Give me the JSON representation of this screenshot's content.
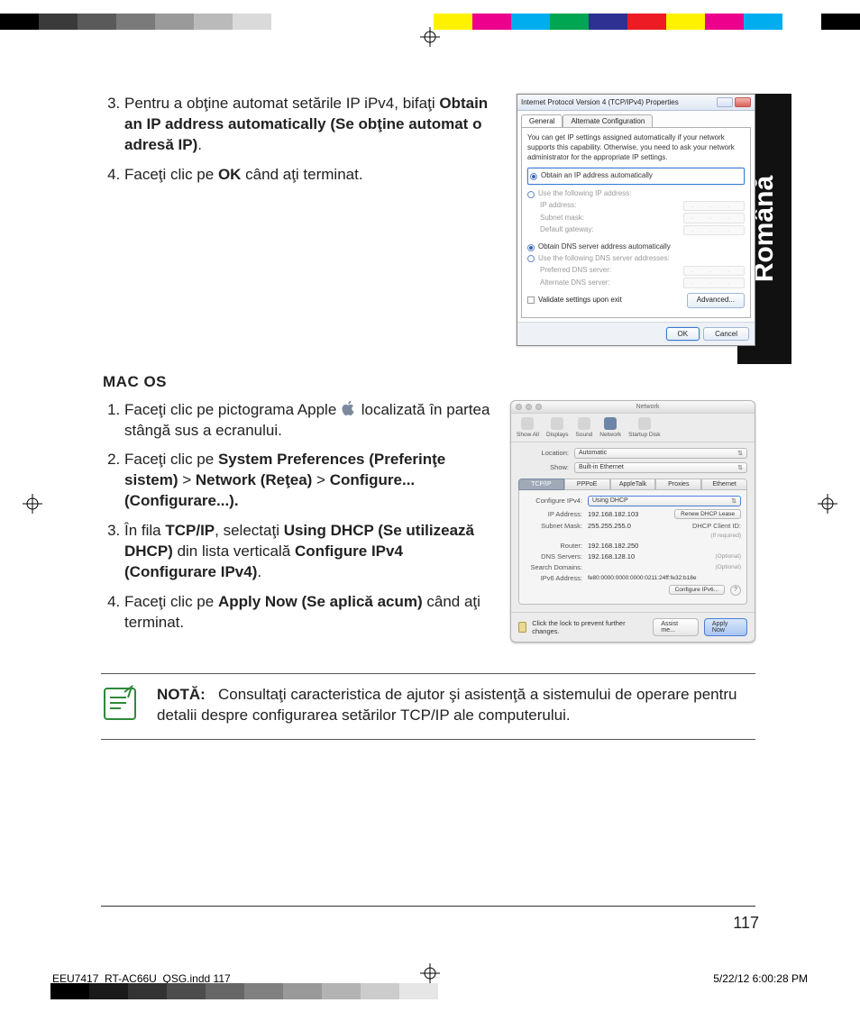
{
  "language_tab": "Română",
  "section1": {
    "start_number": 3,
    "steps": [
      {
        "pre": "Pentru a obţine automat setările IP iPv4, bifaţi ",
        "bold": "Obtain an IP address automatically (Se obţine automat o adresă IP)",
        "post": "."
      },
      {
        "pre": "Faceţi clic pe ",
        "bold": "OK",
        "post": " când aţi terminat."
      }
    ]
  },
  "section2_heading": "MAC OS",
  "section2": {
    "steps": [
      {
        "pre": "Faceţi clic pe pictograma Apple ",
        "post_icon": " localizată în partea stângă sus a ecranului."
      },
      {
        "pre": "Faceţi clic pe ",
        "b1": "System Preferences (Preferinţe sistem)",
        "gt1": " > ",
        "b2": "Network (Reţea)",
        "gt2": " > ",
        "b3": "Configure... (Configurare...).",
        "post": ""
      },
      {
        "pre": "În fila ",
        "b1": "TCP/IP",
        "mid1": ", selectaţi ",
        "b2": "Using DHCP (Se utilizează DHCP)",
        "mid2": " din lista verticală ",
        "b3": "Configure IPv4 (Configurare IPv4)",
        "post": "."
      },
      {
        "pre": "Faceţi clic pe ",
        "b1": "Apply Now (Se aplică acum)",
        "post": " când aţi terminat."
      }
    ]
  },
  "note": {
    "label": "NOTĂ:",
    "text": "Consultaţi caracteristica de ajutor şi asistenţă a sistemului de operare pentru detalii despre configurarea setărilor TCP/IP ale computerului."
  },
  "page_number": "117",
  "imprint_left": "EEU7417_RT-AC66U_QSG.indd   117",
  "imprint_right": "5/22/12   6:00:28 PM",
  "win_dialog": {
    "title": "Internet Protocol Version 4 (TCP/IPv4) Properties",
    "tab_general": "General",
    "tab_alt": "Alternate Configuration",
    "desc": "You can get IP settings assigned automatically if your network supports this capability. Otherwise, you need to ask your network administrator for the appropriate IP settings.",
    "r_auto_ip": "Obtain an IP address automatically",
    "r_use_ip": "Use the following IP address:",
    "f_ip": "IP address:",
    "f_sub": "Subnet mask:",
    "f_gw": "Default gateway:",
    "r_auto_dns": "Obtain DNS server address automatically",
    "r_use_dns": "Use the following DNS server addresses:",
    "f_pdns": "Preferred DNS server:",
    "f_adns": "Alternate DNS server:",
    "chk_validate": "Validate settings upon exit",
    "btn_adv": "Advanced...",
    "btn_ok": "OK",
    "btn_cancel": "Cancel"
  },
  "mac_dialog": {
    "title": "Network",
    "tb_showall": "Show All",
    "tb_displays": "Displays",
    "tb_sound": "Sound",
    "tb_network": "Network",
    "tb_startup": "Startup Disk",
    "loc_label": "Location:",
    "loc_value": "Automatic",
    "show_label": "Show:",
    "show_value": "Built-in Ethernet",
    "tabs": [
      "TCP/IP",
      "PPPoE",
      "AppleTalk",
      "Proxies",
      "Ethernet"
    ],
    "cfg_label": "Configure IPv4:",
    "cfg_value": "Using DHCP",
    "ip_label": "IP Address:",
    "ip_value": "192.168.182.103",
    "renew": "Renew DHCP Lease",
    "sm_label": "Subnet Mask:",
    "sm_value": "255.255.255.0",
    "cid_label": "DHCP Client ID:",
    "cid_hint": "(If required)",
    "rt_label": "Router:",
    "rt_value": "192.168.182.250",
    "dns_label": "DNS Servers:",
    "dns_value": "192.168.128.10",
    "dns_hint": "(Optional)",
    "sd_label": "Search Domains:",
    "sd_hint": "(Optional)",
    "v6_label": "IPv6 Address:",
    "v6_value": "fe80:0000:0000:0000:0211:24ff:fe32:b18e",
    "cfg6": "Configure IPv6...",
    "lock_text": "Click the lock to prevent further changes.",
    "assist": "Assist me...",
    "apply": "Apply Now"
  },
  "color_strip_top": [
    "#000000",
    "#3a3a3a",
    "#5a5a5a",
    "#7a7a7a",
    "#9a9a9a",
    "#bababa",
    "#dadada",
    "#ffffff"
  ],
  "color_strip_right": [
    "#fff200",
    "#ec008c",
    "#00aeef",
    "#00a651",
    "#2e3192",
    "#ed1c24",
    "#fff200",
    "#ec008c",
    "#00aeef",
    "#ffffff",
    "#000000"
  ],
  "bottom_grad": [
    "#000000",
    "#1a1a1a",
    "#333333",
    "#4d4d4d",
    "#666666",
    "#808080",
    "#999999",
    "#b3b3b3",
    "#cccccc",
    "#e6e6e6",
    "#ffffff"
  ]
}
